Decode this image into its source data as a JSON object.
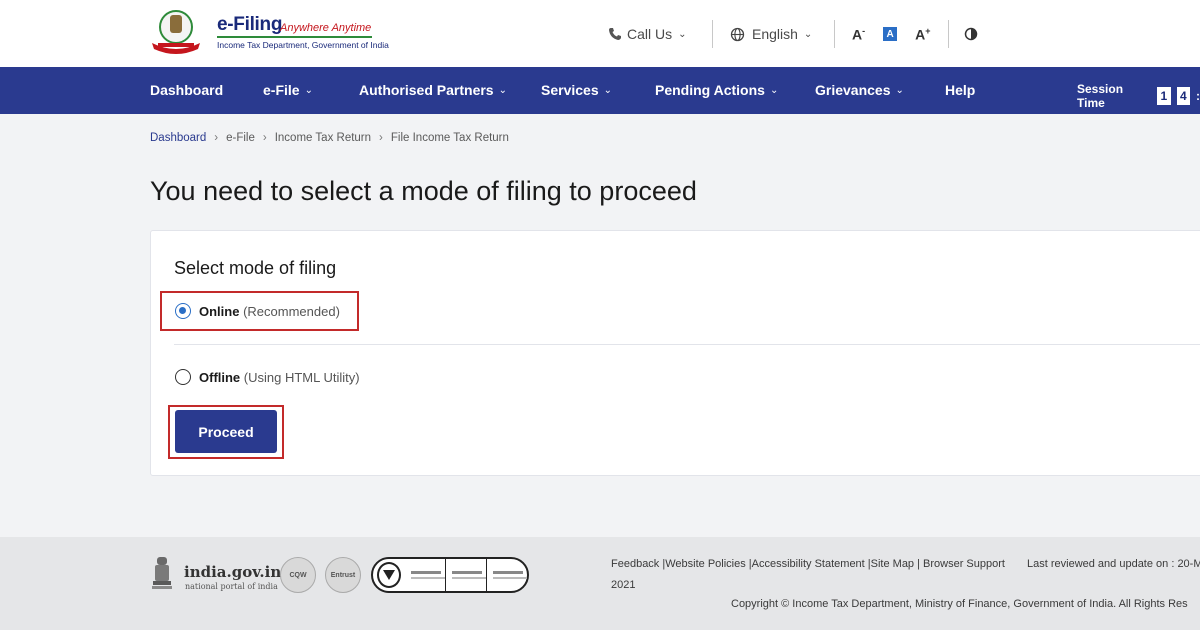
{
  "header": {
    "brand_title": "e-Filing",
    "brand_tagline": "Anywhere Anytime",
    "brand_subtitle": "Income Tax Department, Government of India",
    "call_us": "Call Us",
    "language": "English",
    "font_decrease": "A",
    "font_normal": "A",
    "font_increase": "A",
    "font_minus_sup": "-",
    "font_plus_sup": "+"
  },
  "nav": {
    "items": [
      {
        "label": "Dashboard"
      },
      {
        "label": "e-File"
      },
      {
        "label": "Authorised Partners"
      },
      {
        "label": "Services"
      },
      {
        "label": "Pending Actions"
      },
      {
        "label": "Grievances"
      },
      {
        "label": "Help"
      }
    ],
    "session_label": "Session Time",
    "session_digits": [
      "1",
      "4",
      ":"
    ]
  },
  "breadcrumb": [
    "Dashboard",
    "e-File",
    "Income Tax Return",
    "File Income Tax Return"
  ],
  "page_title": "You need to select a mode of filing to proceed",
  "card": {
    "title": "Select mode of filing",
    "options": [
      {
        "label": "Online",
        "desc": "(Recommended)",
        "selected": true
      },
      {
        "label": "Offline",
        "desc": "(Using HTML Utility)",
        "selected": false
      }
    ],
    "proceed_label": "Proceed"
  },
  "footer": {
    "india_title": "india.gov.in",
    "india_sub": "national portal of india",
    "links": "Feedback |Website Policies |Accessibility Statement |Site Map | Browser Support",
    "reviewed": "Last reviewed and update on : 20-M",
    "year": "2021",
    "copyright": "Copyright © Income Tax Department, Ministry of Finance, Government of India. All Rights Res"
  },
  "colors": {
    "nav_bg": "#2a3a8f",
    "accent_blue": "#2a6ec6",
    "highlight_red": "#c32a2a",
    "brand_red": "#c5161d",
    "brand_green": "#2e8b3a"
  },
  "icons": {
    "call": "phone-icon",
    "language": "globe-icon",
    "contrast": "contrast-icon",
    "dropdown": "chevron-down-icon"
  }
}
